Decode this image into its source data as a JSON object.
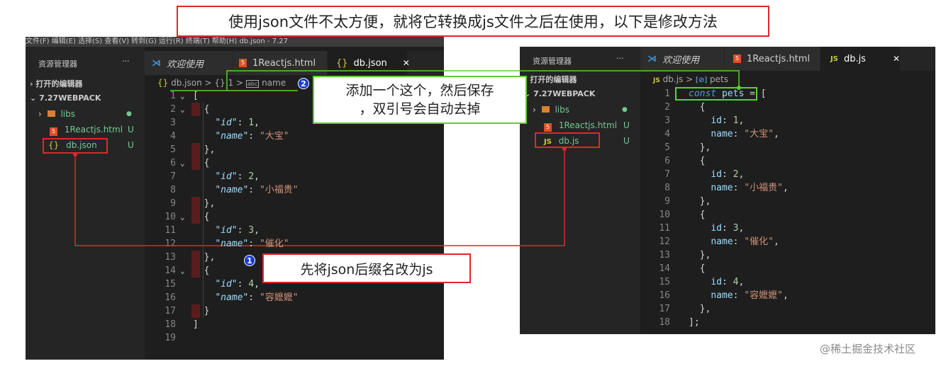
{
  "banner": {
    "text": "使用json文件不太方便，就将它转换成js文件之后在使用，以下是修改方法"
  },
  "left": {
    "menubar": "文件(F)   编辑(E)   选择(S)   查看(V)   转到(G)   运行(R)   终端(T)   帮助(H)                                                                    db.json - 7.27",
    "explorer_title": "资源管理器",
    "more": "···",
    "open_editors": "打开的编辑器",
    "project": "7.27WEBPACK",
    "files": [
      {
        "icon": "folder",
        "name": "libs",
        "status": "●"
      },
      {
        "icon": "html",
        "name": "1Reactjs.html",
        "status": "U"
      },
      {
        "icon": "json",
        "name": "db.json",
        "status": "U"
      }
    ],
    "tabs": [
      {
        "label": "欢迎使用"
      },
      {
        "label": "1Reactjs.html"
      },
      {
        "label": "db.json",
        "close": "✕"
      }
    ],
    "breadcrumb": {
      "file": "db.json",
      "sep": ">",
      "node": "{} 1",
      "prop": "name"
    },
    "lines": [
      "1",
      "2",
      "3",
      "4",
      "5",
      "6",
      "7",
      "8",
      "9",
      "10",
      "11",
      "12",
      "13",
      "14",
      "15",
      "16",
      "17",
      "18",
      "19"
    ],
    "code": [
      {
        "t": "b",
        "v": "["
      },
      {
        "t": "b",
        "v": "{",
        "ind": 1
      },
      {
        "t": "kv",
        "k": "\"id\"",
        "v": "1",
        "vt": "num",
        "ind": 2
      },
      {
        "t": "kv",
        "k": "\"name\"",
        "v": "\"大宝\"",
        "vt": "str",
        "ind": 2,
        "last": true
      },
      {
        "t": "b",
        "v": "},",
        "ind": 1
      },
      {
        "t": "b",
        "v": "{",
        "ind": 1
      },
      {
        "t": "kv",
        "k": "\"id\"",
        "v": "2",
        "vt": "num",
        "ind": 2
      },
      {
        "t": "kv",
        "k": "\"name\"",
        "v": "\"小福贵\"",
        "vt": "str",
        "ind": 2,
        "last": true
      },
      {
        "t": "b",
        "v": "},",
        "ind": 1
      },
      {
        "t": "b",
        "v": "{",
        "ind": 1
      },
      {
        "t": "kv",
        "k": "\"id\"",
        "v": "3",
        "vt": "num",
        "ind": 2
      },
      {
        "t": "kv",
        "k": "\"name\"",
        "v": "\"催化\"",
        "vt": "str",
        "ind": 2,
        "last": true
      },
      {
        "t": "b",
        "v": "},",
        "ind": 1
      },
      {
        "t": "b",
        "v": "{",
        "ind": 1
      },
      {
        "t": "kv",
        "k": "\"id\"",
        "v": "4",
        "vt": "num",
        "ind": 2
      },
      {
        "t": "kv",
        "k": "\"name\"",
        "v": "\"容嬷嬷\"",
        "vt": "str",
        "ind": 2,
        "last": true
      },
      {
        "t": "b",
        "v": "}",
        "ind": 1
      },
      {
        "t": "b",
        "v": "]"
      },
      {
        "t": "b",
        "v": ""
      }
    ]
  },
  "right": {
    "explorer_title": "资源管理器",
    "more": "···",
    "open_editors": "打开的编辑器",
    "project": "7.27WEBPACK",
    "files": [
      {
        "icon": "folder",
        "name": "libs",
        "status": "●"
      },
      {
        "icon": "html",
        "name": "1Reactjs.html",
        "status": "U"
      },
      {
        "icon": "js",
        "name": "db.js",
        "status": "U"
      }
    ],
    "tabs": [
      {
        "label": "欢迎使用"
      },
      {
        "label": "1Reactjs.html"
      },
      {
        "label": "db.js",
        "close": "✕"
      }
    ],
    "breadcrumb": {
      "file": "db.js",
      "sep": ">",
      "prop": "pets"
    },
    "lines": [
      "1",
      "2",
      "3",
      "4",
      "5",
      "6",
      "7",
      "8",
      "9",
      "10",
      "11",
      "12",
      "13",
      "14",
      "15",
      "16",
      "17",
      "18"
    ],
    "code": [
      {
        "t": "decl",
        "kw": "const",
        "name": "pets",
        "op": "=",
        "br": "["
      },
      {
        "t": "b",
        "v": "{",
        "ind": 1
      },
      {
        "t": "kv",
        "k": "id",
        "v": "1",
        "vt": "num",
        "ind": 2
      },
      {
        "t": "kv",
        "k": "name",
        "v": "\"大宝\"",
        "vt": "str",
        "ind": 2
      },
      {
        "t": "b",
        "v": "},",
        "ind": 1
      },
      {
        "t": "b",
        "v": "{",
        "ind": 1
      },
      {
        "t": "kv",
        "k": "id",
        "v": "2",
        "vt": "num",
        "ind": 2
      },
      {
        "t": "kv",
        "k": "name",
        "v": "\"小福贵\"",
        "vt": "str",
        "ind": 2
      },
      {
        "t": "b",
        "v": "},",
        "ind": 1
      },
      {
        "t": "b",
        "v": "{",
        "ind": 1
      },
      {
        "t": "kv",
        "k": "id",
        "v": "3",
        "vt": "num",
        "ind": 2
      },
      {
        "t": "kv",
        "k": "name",
        "v": "\"催化\"",
        "vt": "str",
        "ind": 2
      },
      {
        "t": "b",
        "v": "},",
        "ind": 1
      },
      {
        "t": "b",
        "v": "{",
        "ind": 1
      },
      {
        "t": "kv",
        "k": "id",
        "v": "4",
        "vt": "num",
        "ind": 2
      },
      {
        "t": "kv",
        "k": "name",
        "v": "\"容嬷嬷\"",
        "vt": "str",
        "ind": 2
      },
      {
        "t": "b",
        "v": "},",
        "ind": 1
      },
      {
        "t": "b",
        "v": "];"
      }
    ]
  },
  "annotations": {
    "step1_num": "1",
    "step1_text": "先将json后缀名改为js",
    "step2_num": "2",
    "step2_text_1": "添加一个这个，然后保存",
    "step2_text_2": "，双引号会自动去掉"
  },
  "watermark": "@稀土掘金技术社区",
  "colors": {
    "red": "#e0272c",
    "green": "#5ad22a",
    "editor_bg": "#1e1e1e",
    "sidebar_bg": "#252526"
  }
}
